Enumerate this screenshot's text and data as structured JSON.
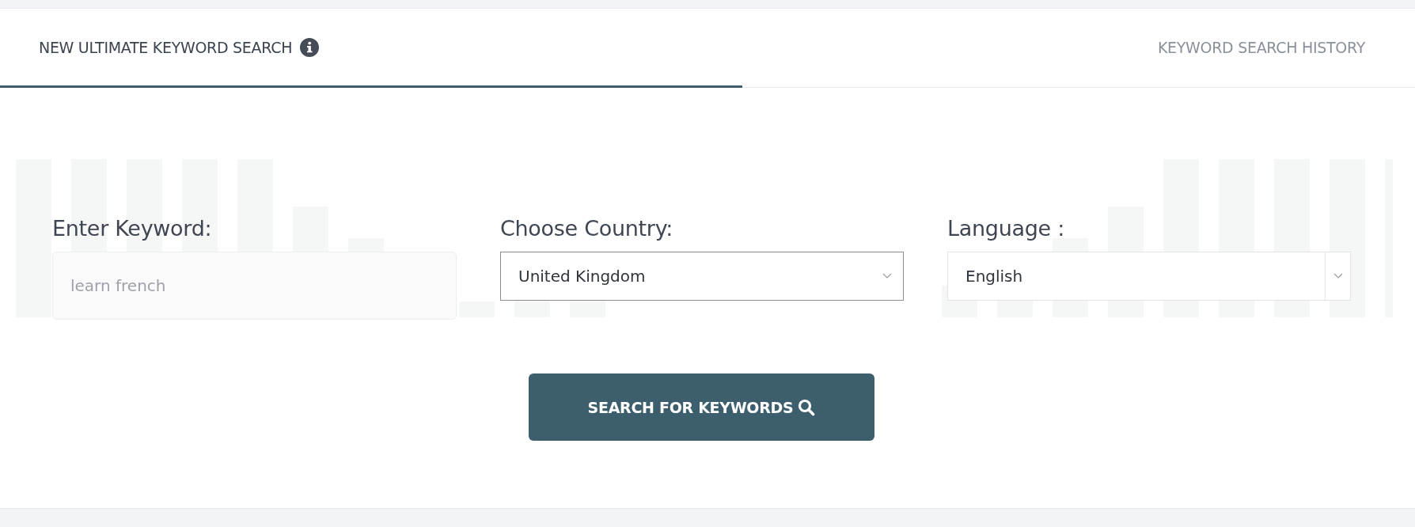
{
  "tabs": [
    {
      "label": "NEW ULTIMATE KEYWORD SEARCH",
      "selected": true,
      "info": true
    },
    {
      "label": "KEYWORD SEARCH HISTORY",
      "selected": false,
      "info": false
    }
  ],
  "fields": [
    {
      "kind": "text",
      "label": "Enter Keyword:",
      "placeholder": "learn french"
    },
    {
      "kind": "select",
      "label": "Choose Country:",
      "value": "United Kingdom"
    },
    {
      "kind": "select-split",
      "label": "Language :",
      "value": "English"
    }
  ],
  "button": {
    "label": "SEARCH FOR KEYWORDS"
  }
}
